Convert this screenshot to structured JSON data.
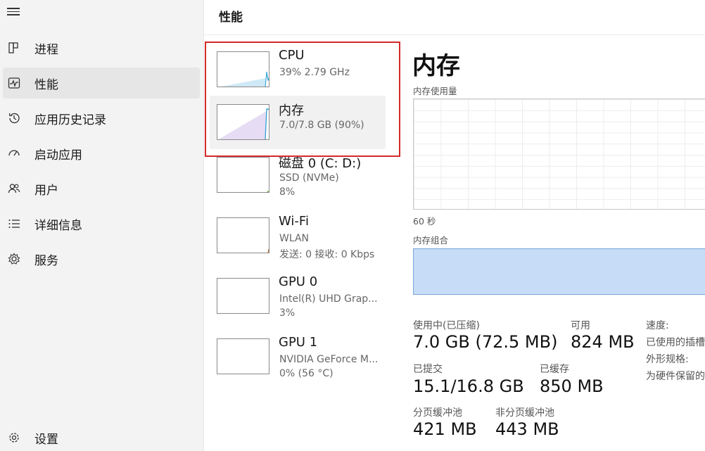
{
  "sidebar": {
    "items": [
      {
        "label": "进程",
        "icon": "processes-icon"
      },
      {
        "label": "性能",
        "icon": "performance-icon"
      },
      {
        "label": "应用历史记录",
        "icon": "history-icon"
      },
      {
        "label": "启动应用",
        "icon": "startup-icon"
      },
      {
        "label": "用户",
        "icon": "users-icon"
      },
      {
        "label": "详细信息",
        "icon": "details-icon"
      },
      {
        "label": "服务",
        "icon": "services-icon"
      }
    ],
    "settings_label": "设置"
  },
  "header": {
    "title": "性能"
  },
  "resources": [
    {
      "name": "CPU",
      "sub1": "39% 2.79 GHz"
    },
    {
      "name": "内存",
      "sub1": "7.0/7.8 GB (90%)"
    },
    {
      "name": "磁盘 0 (C: D:)",
      "sub1": "SSD (NVMe)",
      "sub2": "8%"
    },
    {
      "name": "Wi-Fi",
      "sub1": "WLAN",
      "sub2": "发送: 0 接收: 0 Kbps"
    },
    {
      "name": "GPU 0",
      "sub1": "Intel(R) UHD Grap...",
      "sub2": "3%"
    },
    {
      "name": "GPU 1",
      "sub1": "NVIDIA GeForce M...",
      "sub2": "0% (56 °C)"
    }
  ],
  "detail": {
    "title": "内存",
    "usage_label": "内存使用量",
    "time_label": "60 秒",
    "composition_label": "内存组合",
    "stats": {
      "in_use_label": "使用中(已压缩)",
      "in_use_value": "7.0 GB (72.5 MB)",
      "available_label": "可用",
      "available_value": "824 MB",
      "committed_label": "已提交",
      "committed_value": "15.1/16.8 GB",
      "cached_label": "已缓存",
      "cached_value": "850 MB",
      "paged_label": "分页缓冲池",
      "paged_value": "421 MB",
      "nonpaged_label": "非分页缓冲池",
      "nonpaged_value": "443 MB"
    },
    "right_info": {
      "speed_label": "速度:",
      "slots_label": "已使用的插槽",
      "form_label": "外形规格:",
      "reserved_label": "为硬件保留的"
    }
  },
  "colors": {
    "highlight": "#d42a2a",
    "cpu_line": "#1f9bd1",
    "memory_line": "#7a4bb5",
    "disk_line": "#4e9a06",
    "wifi_line": "#b35c17",
    "composition_fill": "#c7dcf6"
  }
}
